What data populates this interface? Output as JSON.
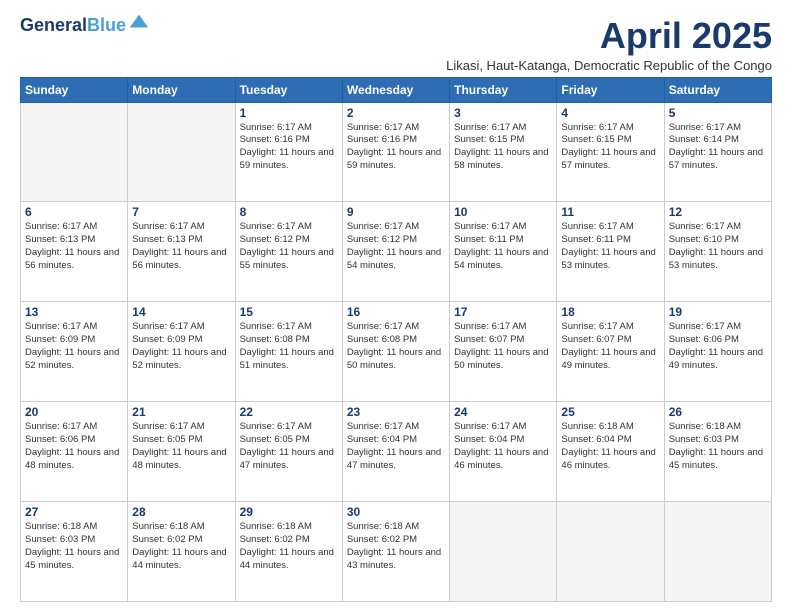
{
  "logo": {
    "line1": "General",
    "line2": "Blue"
  },
  "title": "April 2025",
  "subtitle": "Likasi, Haut-Katanga, Democratic Republic of the Congo",
  "days_header": [
    "Sunday",
    "Monday",
    "Tuesday",
    "Wednesday",
    "Thursday",
    "Friday",
    "Saturday"
  ],
  "weeks": [
    [
      {
        "day": "",
        "info": ""
      },
      {
        "day": "",
        "info": ""
      },
      {
        "day": "1",
        "info": "Sunrise: 6:17 AM\nSunset: 6:16 PM\nDaylight: 11 hours\nand 59 minutes."
      },
      {
        "day": "2",
        "info": "Sunrise: 6:17 AM\nSunset: 6:16 PM\nDaylight: 11 hours\nand 59 minutes."
      },
      {
        "day": "3",
        "info": "Sunrise: 6:17 AM\nSunset: 6:15 PM\nDaylight: 11 hours\nand 58 minutes."
      },
      {
        "day": "4",
        "info": "Sunrise: 6:17 AM\nSunset: 6:15 PM\nDaylight: 11 hours\nand 57 minutes."
      },
      {
        "day": "5",
        "info": "Sunrise: 6:17 AM\nSunset: 6:14 PM\nDaylight: 11 hours\nand 57 minutes."
      }
    ],
    [
      {
        "day": "6",
        "info": "Sunrise: 6:17 AM\nSunset: 6:13 PM\nDaylight: 11 hours\nand 56 minutes."
      },
      {
        "day": "7",
        "info": "Sunrise: 6:17 AM\nSunset: 6:13 PM\nDaylight: 11 hours\nand 56 minutes."
      },
      {
        "day": "8",
        "info": "Sunrise: 6:17 AM\nSunset: 6:12 PM\nDaylight: 11 hours\nand 55 minutes."
      },
      {
        "day": "9",
        "info": "Sunrise: 6:17 AM\nSunset: 6:12 PM\nDaylight: 11 hours\nand 54 minutes."
      },
      {
        "day": "10",
        "info": "Sunrise: 6:17 AM\nSunset: 6:11 PM\nDaylight: 11 hours\nand 54 minutes."
      },
      {
        "day": "11",
        "info": "Sunrise: 6:17 AM\nSunset: 6:11 PM\nDaylight: 11 hours\nand 53 minutes."
      },
      {
        "day": "12",
        "info": "Sunrise: 6:17 AM\nSunset: 6:10 PM\nDaylight: 11 hours\nand 53 minutes."
      }
    ],
    [
      {
        "day": "13",
        "info": "Sunrise: 6:17 AM\nSunset: 6:09 PM\nDaylight: 11 hours\nand 52 minutes."
      },
      {
        "day": "14",
        "info": "Sunrise: 6:17 AM\nSunset: 6:09 PM\nDaylight: 11 hours\nand 52 minutes."
      },
      {
        "day": "15",
        "info": "Sunrise: 6:17 AM\nSunset: 6:08 PM\nDaylight: 11 hours\nand 51 minutes."
      },
      {
        "day": "16",
        "info": "Sunrise: 6:17 AM\nSunset: 6:08 PM\nDaylight: 11 hours\nand 50 minutes."
      },
      {
        "day": "17",
        "info": "Sunrise: 6:17 AM\nSunset: 6:07 PM\nDaylight: 11 hours\nand 50 minutes."
      },
      {
        "day": "18",
        "info": "Sunrise: 6:17 AM\nSunset: 6:07 PM\nDaylight: 11 hours\nand 49 minutes."
      },
      {
        "day": "19",
        "info": "Sunrise: 6:17 AM\nSunset: 6:06 PM\nDaylight: 11 hours\nand 49 minutes."
      }
    ],
    [
      {
        "day": "20",
        "info": "Sunrise: 6:17 AM\nSunset: 6:06 PM\nDaylight: 11 hours\nand 48 minutes."
      },
      {
        "day": "21",
        "info": "Sunrise: 6:17 AM\nSunset: 6:05 PM\nDaylight: 11 hours\nand 48 minutes."
      },
      {
        "day": "22",
        "info": "Sunrise: 6:17 AM\nSunset: 6:05 PM\nDaylight: 11 hours\nand 47 minutes."
      },
      {
        "day": "23",
        "info": "Sunrise: 6:17 AM\nSunset: 6:04 PM\nDaylight: 11 hours\nand 47 minutes."
      },
      {
        "day": "24",
        "info": "Sunrise: 6:17 AM\nSunset: 6:04 PM\nDaylight: 11 hours\nand 46 minutes."
      },
      {
        "day": "25",
        "info": "Sunrise: 6:18 AM\nSunset: 6:04 PM\nDaylight: 11 hours\nand 46 minutes."
      },
      {
        "day": "26",
        "info": "Sunrise: 6:18 AM\nSunset: 6:03 PM\nDaylight: 11 hours\nand 45 minutes."
      }
    ],
    [
      {
        "day": "27",
        "info": "Sunrise: 6:18 AM\nSunset: 6:03 PM\nDaylight: 11 hours\nand 45 minutes."
      },
      {
        "day": "28",
        "info": "Sunrise: 6:18 AM\nSunset: 6:02 PM\nDaylight: 11 hours\nand 44 minutes."
      },
      {
        "day": "29",
        "info": "Sunrise: 6:18 AM\nSunset: 6:02 PM\nDaylight: 11 hours\nand 44 minutes."
      },
      {
        "day": "30",
        "info": "Sunrise: 6:18 AM\nSunset: 6:02 PM\nDaylight: 11 hours\nand 43 minutes."
      },
      {
        "day": "",
        "info": ""
      },
      {
        "day": "",
        "info": ""
      },
      {
        "day": "",
        "info": ""
      }
    ]
  ]
}
